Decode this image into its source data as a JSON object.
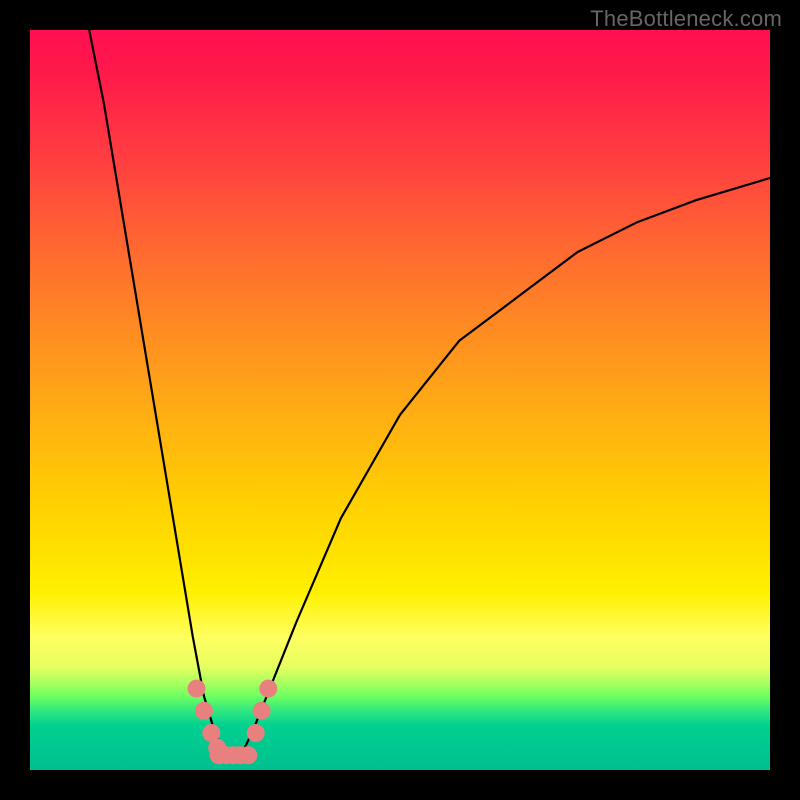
{
  "watermark": "TheBottleneck.com",
  "chart_data": {
    "type": "line",
    "title": "",
    "xlabel": "",
    "ylabel": "",
    "xlim": [
      0,
      100
    ],
    "ylim": [
      0,
      100
    ],
    "grid": false,
    "series": [
      {
        "name": "curve",
        "color": "#000000",
        "x": [
          8,
          10,
          12,
          14,
          16,
          18,
          20,
          22,
          23.5,
          25,
          26,
          27,
          28,
          29,
          30,
          32,
          36,
          42,
          50,
          58,
          66,
          74,
          82,
          90,
          100
        ],
        "y": [
          100,
          90,
          78,
          66,
          54,
          42,
          30,
          18,
          10,
          5,
          3,
          2,
          2,
          3,
          5,
          10,
          20,
          34,
          48,
          58,
          64,
          70,
          74,
          77,
          80
        ]
      },
      {
        "name": "marker-left",
        "color": "#e88080",
        "type": "marker",
        "x": [
          22.5,
          23.5,
          24.5,
          25.3
        ],
        "y": [
          11,
          8,
          5,
          3
        ]
      },
      {
        "name": "marker-bottom",
        "color": "#e88080",
        "type": "marker",
        "x": [
          25.5,
          26.5,
          27.5,
          28.5,
          29.5
        ],
        "y": [
          2,
          2,
          2,
          2,
          2
        ]
      },
      {
        "name": "marker-right",
        "color": "#e88080",
        "type": "marker",
        "x": [
          30.5,
          31.3,
          32.2
        ],
        "y": [
          5,
          8,
          11
        ]
      }
    ],
    "background": {
      "type": "vertical-gradient",
      "stops": [
        {
          "pos": 0.0,
          "color": "#ff1050"
        },
        {
          "pos": 0.5,
          "color": "#ffb410"
        },
        {
          "pos": 0.78,
          "color": "#ffff40"
        },
        {
          "pos": 0.9,
          "color": "#60ff60"
        },
        {
          "pos": 1.0,
          "color": "#00c090"
        }
      ]
    }
  }
}
